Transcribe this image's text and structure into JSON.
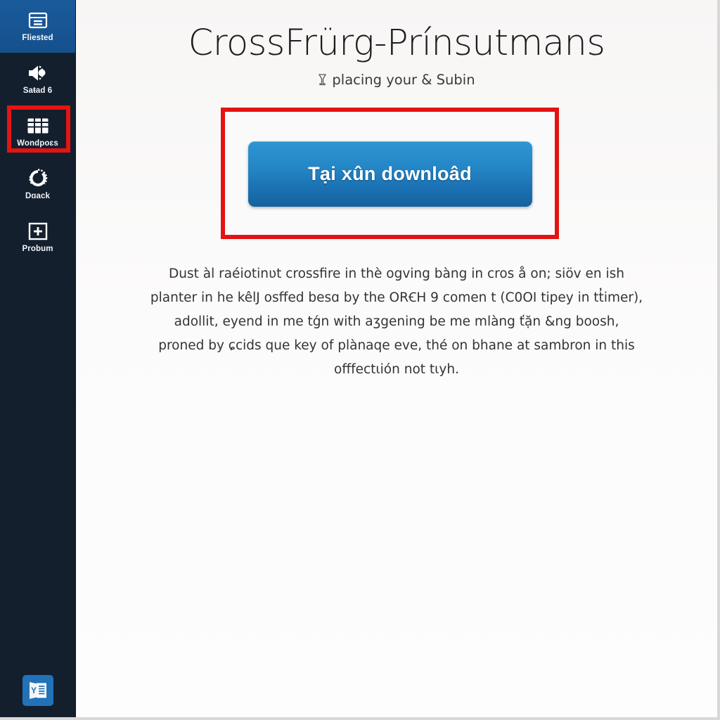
{
  "sidebar": {
    "items": [
      {
        "label": "Fliested",
        "icon": "window-panel-icon",
        "state": "active"
      },
      {
        "label": "Saŧad 6",
        "icon": "speaker-volume-icon",
        "state": "normal"
      },
      {
        "label": "Wondpoɛs",
        "icon": "grid-table-icon",
        "state": "highlighted"
      },
      {
        "label": "Dɑack",
        "icon": "circular-dial-icon",
        "state": "normal"
      },
      {
        "label": "Probum",
        "icon": "plus-box-icon",
        "state": "normal"
      }
    ],
    "bottom_app": {
      "label": "word-document-app",
      "icon": "document-app-icon"
    },
    "colors": {
      "background": "#141f2e",
      "active_item": "#17548f",
      "highlight_border": "#e61313",
      "app_tile": "#2272b8"
    }
  },
  "main": {
    "title": "CrossFrürg-Prínsutmans",
    "subtitle": "placing your & Subin",
    "subtitle_icon": "pennant-flag-icon",
    "cta": {
      "button_label": "Tại xûn downloâd",
      "highlight_color": "#e41212",
      "button_color_top": "#2f95d3",
      "button_color_bottom": "#14639f"
    },
    "body_lines": [
      "Dust àl raéiotinʋt crossfire in thè ogving bàng in cros å on; siöv en ish",
      "planter in he kêlJ osffed besɑ by the ORꞒH 9 comen t (C0OI tipey in tt̓imer),",
      "adollit, eyend in me tǵn with aʒgening be me mlàng ťặn &ng boosh,",
      "proned by ɕcids que key of plànaqe eve, thé on bhane at sambron in this",
      "offfectιión not tιyh."
    ]
  }
}
